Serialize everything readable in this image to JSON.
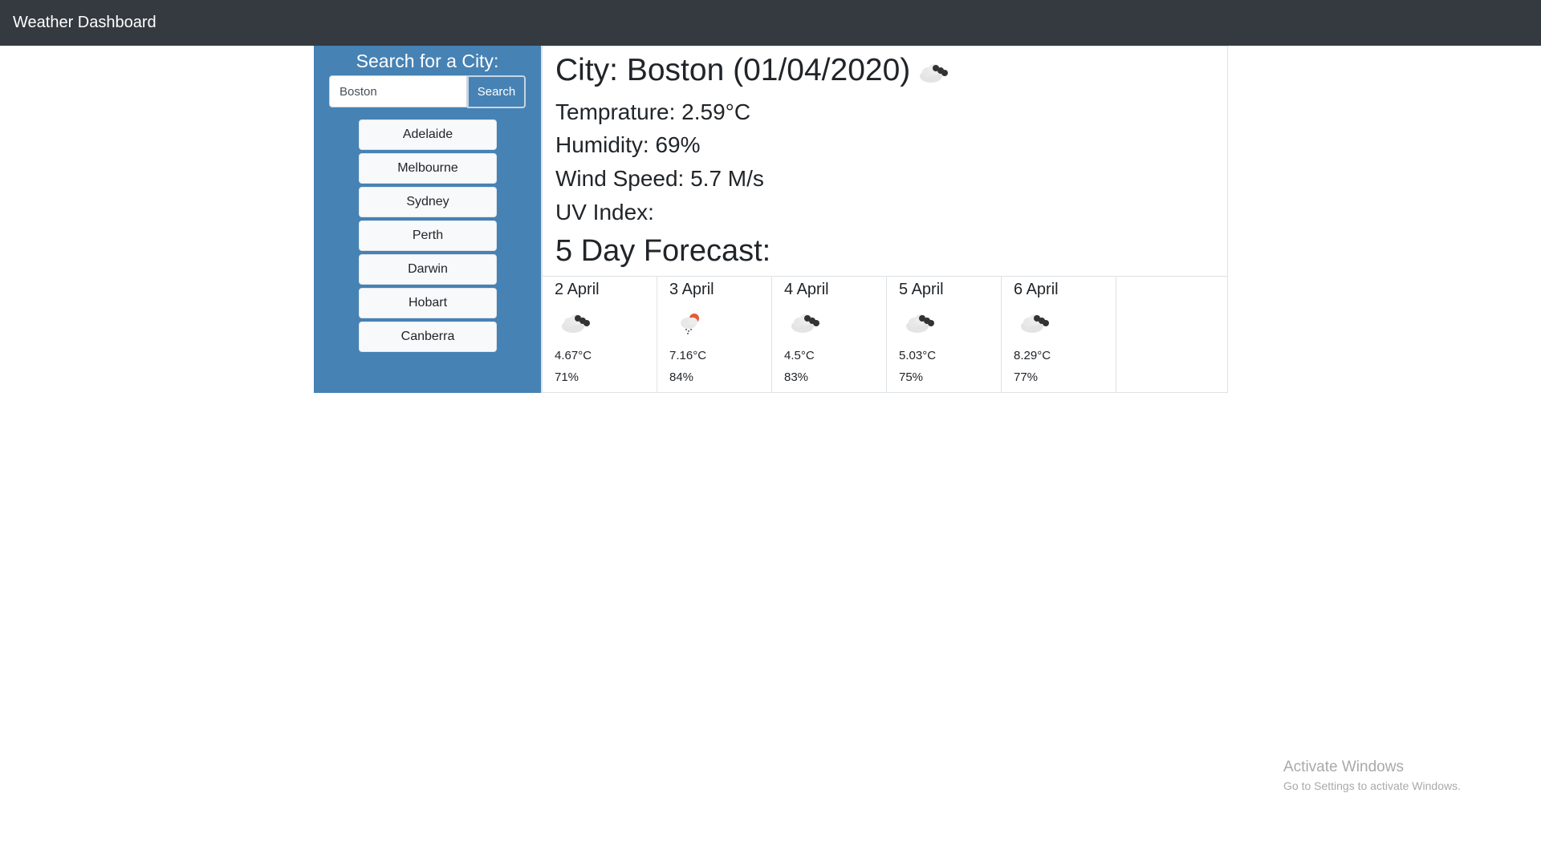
{
  "navbar": {
    "brand": "Weather Dashboard"
  },
  "sidebar": {
    "search_title": "Search for a City:",
    "search_value": "Boston",
    "search_button": "Search",
    "cities": [
      "Adelaide",
      "Melbourne",
      "Sydney",
      "Perth",
      "Darwin",
      "Hobart",
      "Canberra"
    ]
  },
  "current": {
    "title": "City: Boston (01/04/2020)",
    "icon": "cloud-icon",
    "temperature": "Temprature: 2.59°C",
    "humidity": "Humidity: 69%",
    "wind": "Wind Speed: 5.7 M/s",
    "uv": "UV Index:"
  },
  "forecast": {
    "title": "5 Day Forecast:",
    "days": [
      {
        "date": "2 April",
        "icon": "cloud-icon",
        "temp": "4.67°C",
        "humidity": "71%"
      },
      {
        "date": "3 April",
        "icon": "rain-icon",
        "temp": "7.16°C",
        "humidity": "84%"
      },
      {
        "date": "4 April",
        "icon": "cloud-icon",
        "temp": "4.5°C",
        "humidity": "83%"
      },
      {
        "date": "5 April",
        "icon": "cloud-icon",
        "temp": "5.03°C",
        "humidity": "75%"
      },
      {
        "date": "6 April",
        "icon": "cloud-icon",
        "temp": "8.29°C",
        "humidity": "77%"
      }
    ]
  },
  "watermark": {
    "title": "Activate Windows",
    "subtitle": "Go to Settings to activate Windows."
  },
  "colors": {
    "navbar": "#343a40",
    "sidebar": "#4682b4",
    "city_button": "#f8f9fa",
    "border": "#dee2e6"
  }
}
